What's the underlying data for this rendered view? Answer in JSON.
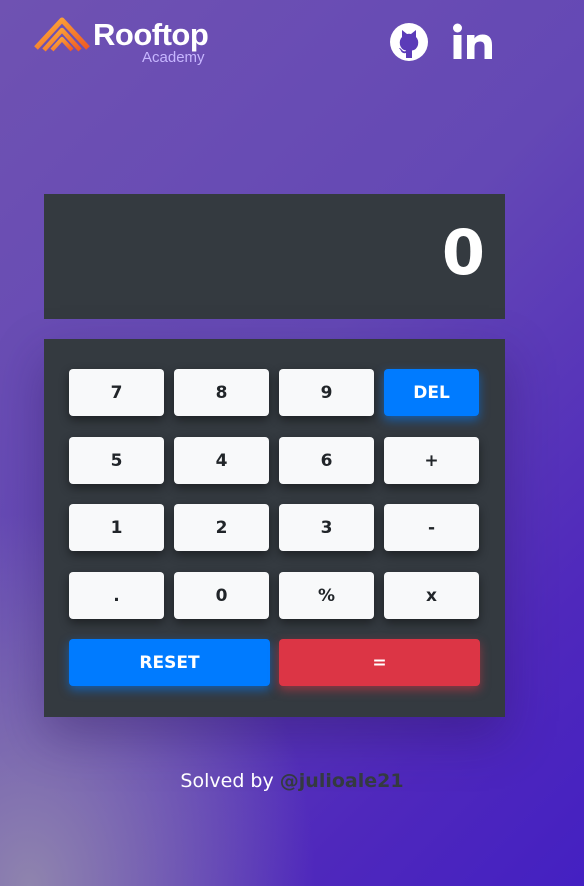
{
  "header": {
    "brand": "Rooftop",
    "brand_sub": "Academy",
    "social": [
      {
        "name": "github",
        "icon": "github-icon"
      },
      {
        "name": "linkedin",
        "icon": "linkedin-icon"
      }
    ]
  },
  "calculator": {
    "display": "0",
    "keys": {
      "k7": "7",
      "k8": "8",
      "k9": "9",
      "del": "DEL",
      "k5": "5",
      "k4": "4",
      "k6": "6",
      "plus": "+",
      "k1": "1",
      "k2": "2",
      "k3": "3",
      "minus": "-",
      "dot": ".",
      "k0": "0",
      "percent": "%",
      "times": "x",
      "reset": "RESET",
      "equals": "="
    }
  },
  "footer": {
    "prefix": "Solved by",
    "handle": "@julioale21"
  },
  "colors": {
    "display_bg": "#343a40",
    "key_bg": "#f8f9fa",
    "accent_blue": "#007bff",
    "accent_red": "#dc3545",
    "logo_orange": "#f5822a"
  }
}
